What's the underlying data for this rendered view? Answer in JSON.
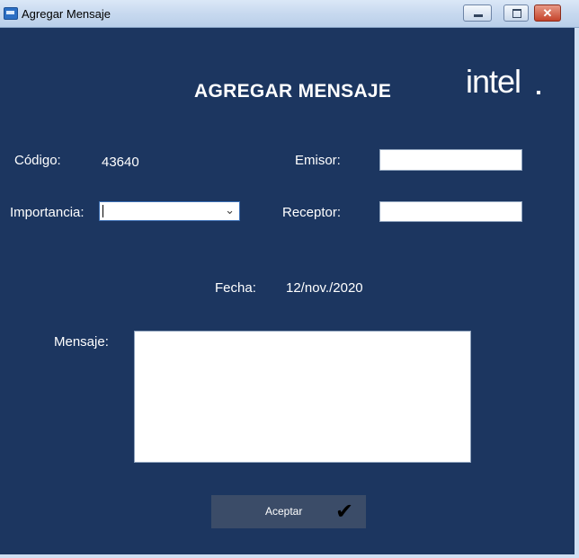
{
  "window": {
    "title": "Agregar Mensaje",
    "close_glyph": "✕"
  },
  "form": {
    "heading": "AGREGAR MENSAJE",
    "logo_text": "intel",
    "codigo_label": "Código:",
    "codigo_value": "43640",
    "emisor_label": "Emisor:",
    "emisor_value": "",
    "importancia_label": "Importancia:",
    "importancia_value": "",
    "receptor_label": "Receptor:",
    "receptor_value": "",
    "fecha_label": "Fecha:",
    "fecha_value": "12/nov./2020",
    "mensaje_label": "Mensaje:",
    "mensaje_value": "",
    "aceptar_label": "Aceptar"
  },
  "icons": {
    "app": "mail-app-icon",
    "minimize": "minimize-icon",
    "maximize": "maximize-icon",
    "close": "close-icon",
    "dropdown": "chevron-down-icon",
    "check": "checkmark-icon"
  },
  "colors": {
    "background": "#1c3660",
    "button": "#3b4c68"
  }
}
